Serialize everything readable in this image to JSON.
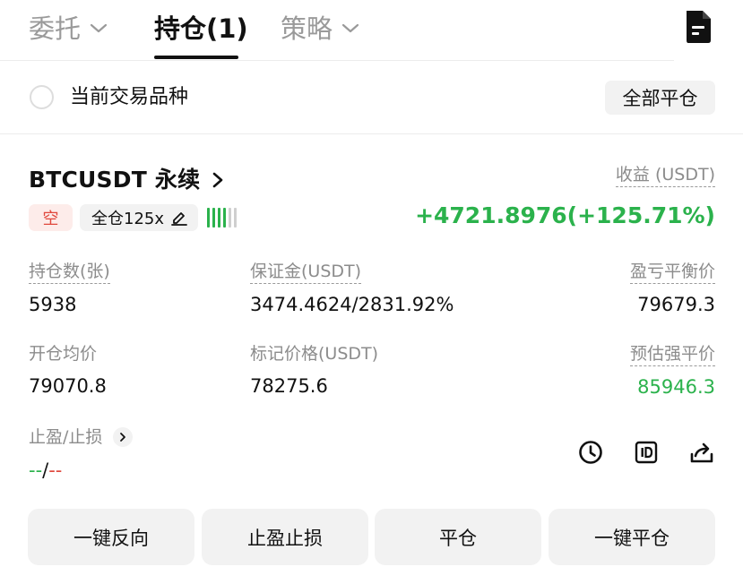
{
  "tabs": {
    "entrust": "委托",
    "positions": "持仓(1)",
    "strategy": "策略"
  },
  "filter": {
    "current_symbol_label": "当前交易品种",
    "close_all_label": "全部平仓"
  },
  "position": {
    "symbol": "BTCUSDT 永续",
    "side_tag": "空",
    "margin_tag": "全仓125x",
    "risk_level": {
      "filled": 4,
      "total": 6
    },
    "pnl_label": "收益 (USDT)",
    "pnl_value": "+4721.8976(+125.71%)",
    "fields": {
      "size_label": "持仓数(张)",
      "size_value": "5938",
      "margin_label": "保证金(USDT)",
      "margin_value": "3474.4624/2831.92%",
      "breakeven_label": "盈亏平衡价",
      "breakeven_value": "79679.3",
      "entry_label": "开仓均价",
      "entry_value": "79070.8",
      "mark_label": "标记价格(USDT)",
      "mark_value": "78275.6",
      "liq_label": "预估强平价",
      "liq_value": "85946.3"
    },
    "tpsl": {
      "label": "止盈/止损",
      "tp_value": "--",
      "separator": "/",
      "sl_value": "--"
    }
  },
  "actions": {
    "reverse": "一键反向",
    "tpsl": "止盈止损",
    "close": "平仓",
    "close_all": "一键平仓"
  },
  "colors": {
    "profit_green": "#2bb24c",
    "loss_red": "#e0483d",
    "muted_text": "#8c8c8c",
    "button_bg": "#f2f2f2"
  },
  "icons": {
    "tab_chevron": "chevron-down-icon",
    "document": "document-icon",
    "symbol_chevron": "chevron-right-icon",
    "edit": "pencil-icon",
    "history": "clock-icon",
    "id": "id-card-icon",
    "share": "share-icon"
  }
}
